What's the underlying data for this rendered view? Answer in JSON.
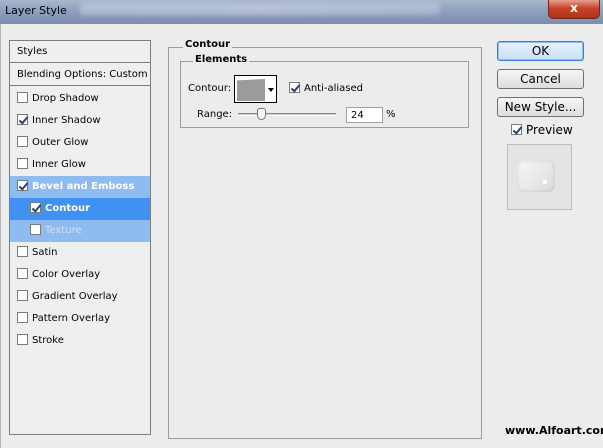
{
  "window": {
    "title": "Layer Style",
    "close_glyph": "x"
  },
  "style_list": {
    "header": "Styles",
    "blending": "Blending Options: Custom",
    "items": [
      {
        "label": "Drop Shadow",
        "checked": false
      },
      {
        "label": "Inner Shadow",
        "checked": true
      },
      {
        "label": "Outer Glow",
        "checked": false
      },
      {
        "label": "Inner Glow",
        "checked": false
      },
      {
        "label": "Bevel and Emboss",
        "checked": true
      },
      {
        "label": "Contour",
        "checked": true
      },
      {
        "label": "Texture",
        "checked": false
      },
      {
        "label": "Satin",
        "checked": false
      },
      {
        "label": "Color Overlay",
        "checked": false
      },
      {
        "label": "Gradient Overlay",
        "checked": false
      },
      {
        "label": "Pattern Overlay",
        "checked": false
      },
      {
        "label": "Stroke",
        "checked": false
      }
    ]
  },
  "panel": {
    "group_title": "Contour",
    "elements_title": "Elements",
    "contour_label": "Contour:",
    "antialiased_label": "Anti-aliased",
    "antialiased_checked": true,
    "range_label": "Range:",
    "range_value": "24",
    "range_unit": "%"
  },
  "buttons": {
    "ok": "OK",
    "cancel": "Cancel",
    "new_style": "New Style..."
  },
  "preview": {
    "label": "Preview",
    "checked": true
  },
  "watermark": "www.Alfoart.com"
}
